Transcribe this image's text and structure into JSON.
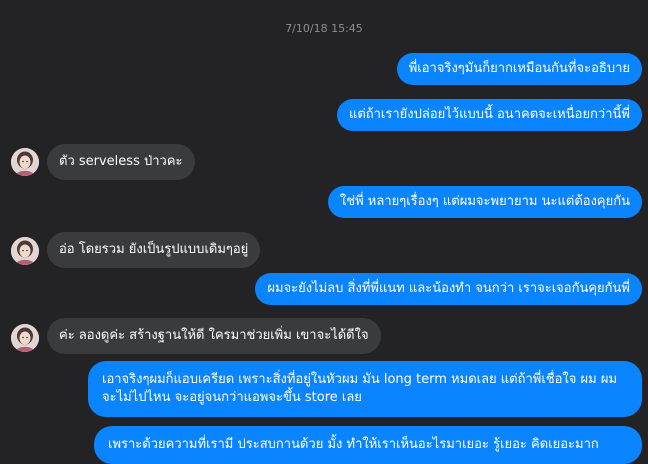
{
  "chat": {
    "timestamp": "7/10/18 15:45",
    "messages": [
      {
        "direction": "outgoing",
        "text": "พี่เอาจริงๆมันก็ยากเหมือนกันที่จะอธิบาย"
      },
      {
        "direction": "outgoing",
        "text": "แต่ถ้าเรายังปล่อยไว้แบบนี้ อนาคตจะเหนื่อยกว่านี้พี่"
      },
      {
        "direction": "incoming",
        "text": "ตัว serveless ป่าวคะ"
      },
      {
        "direction": "outgoing",
        "text": "ใช่พี่ หลายๆเรื่องๆ แต่ผมจะพยายาม นะแต่ต้องคุยกัน"
      },
      {
        "direction": "incoming",
        "text": "อ่อ โดยรวม ยังเป็นรูปแบบเดิมๆอยู่"
      },
      {
        "direction": "outgoing",
        "text": "ผมจะยังไม่ลบ สิ่งที่พี่แนท และน้องทำ จนกว่า เราจะเจอกันคุยกันพี่"
      },
      {
        "direction": "incoming",
        "text": "ค่ะ ลองดูค่ะ สร้างฐานให้ดี ใครมาช่วยเพิ่ม เขาจะได้ดีใจ"
      },
      {
        "direction": "outgoing",
        "text": "เอาจริงๆผมก็แอบเครียด เพราะสิ่งที่อยู่ในหัวผม มัน long term หมดเลย แต่ถ้าพี่เชื่อใจ ผม ผมจะไม่ไปไหน จะอยู่จนกว่าแอพจะขึ้น store เลย"
      },
      {
        "direction": "outgoing",
        "text": "เพราะด้วยความที่เรามี ประสบกานด้วย มั้ง ทำให้เราเห็นอะไรมาเยอะ รู้เยอะ คิดเยอะมาก"
      }
    ]
  },
  "colors": {
    "background": "#232325",
    "outgoing_bubble": "#0a84ff",
    "incoming_bubble": "#3a3b3d",
    "timestamp_text": "#8d8d90"
  },
  "avatar_icon": "user-avatar-photo"
}
